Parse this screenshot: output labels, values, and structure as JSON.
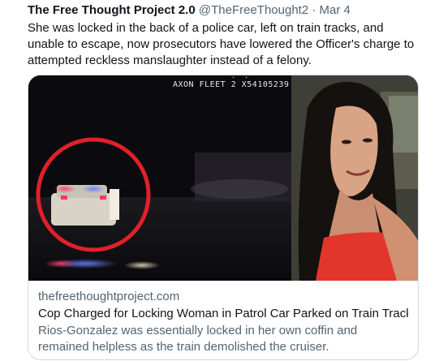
{
  "tweet": {
    "author_name": "The Free Thought Project 2.0",
    "handle": "@TheFreeThought2",
    "separator": "·",
    "date": "Mar 4",
    "text": "She was locked in the back of a police car, left on train tracks, and unable to escape, now prosecutors have lowered the Officer's charge to attempted reckless manslaughter instead of a felony."
  },
  "card": {
    "media_overlay_text": "AXON FLEET 2 X54105239",
    "domain": "thefreethoughtproject.com",
    "title": "Cop Charged for Locking Woman in Patrol Car Parked on Train Track...",
    "description": "Rios-Gonzalez was essentially locked in her own coffin and remained helpless as the train demolished the cruiser."
  },
  "colors": {
    "text_primary": "#0f1419",
    "text_secondary": "#536471",
    "border": "#cfd9de",
    "highlight_circle": "#e0202a"
  }
}
